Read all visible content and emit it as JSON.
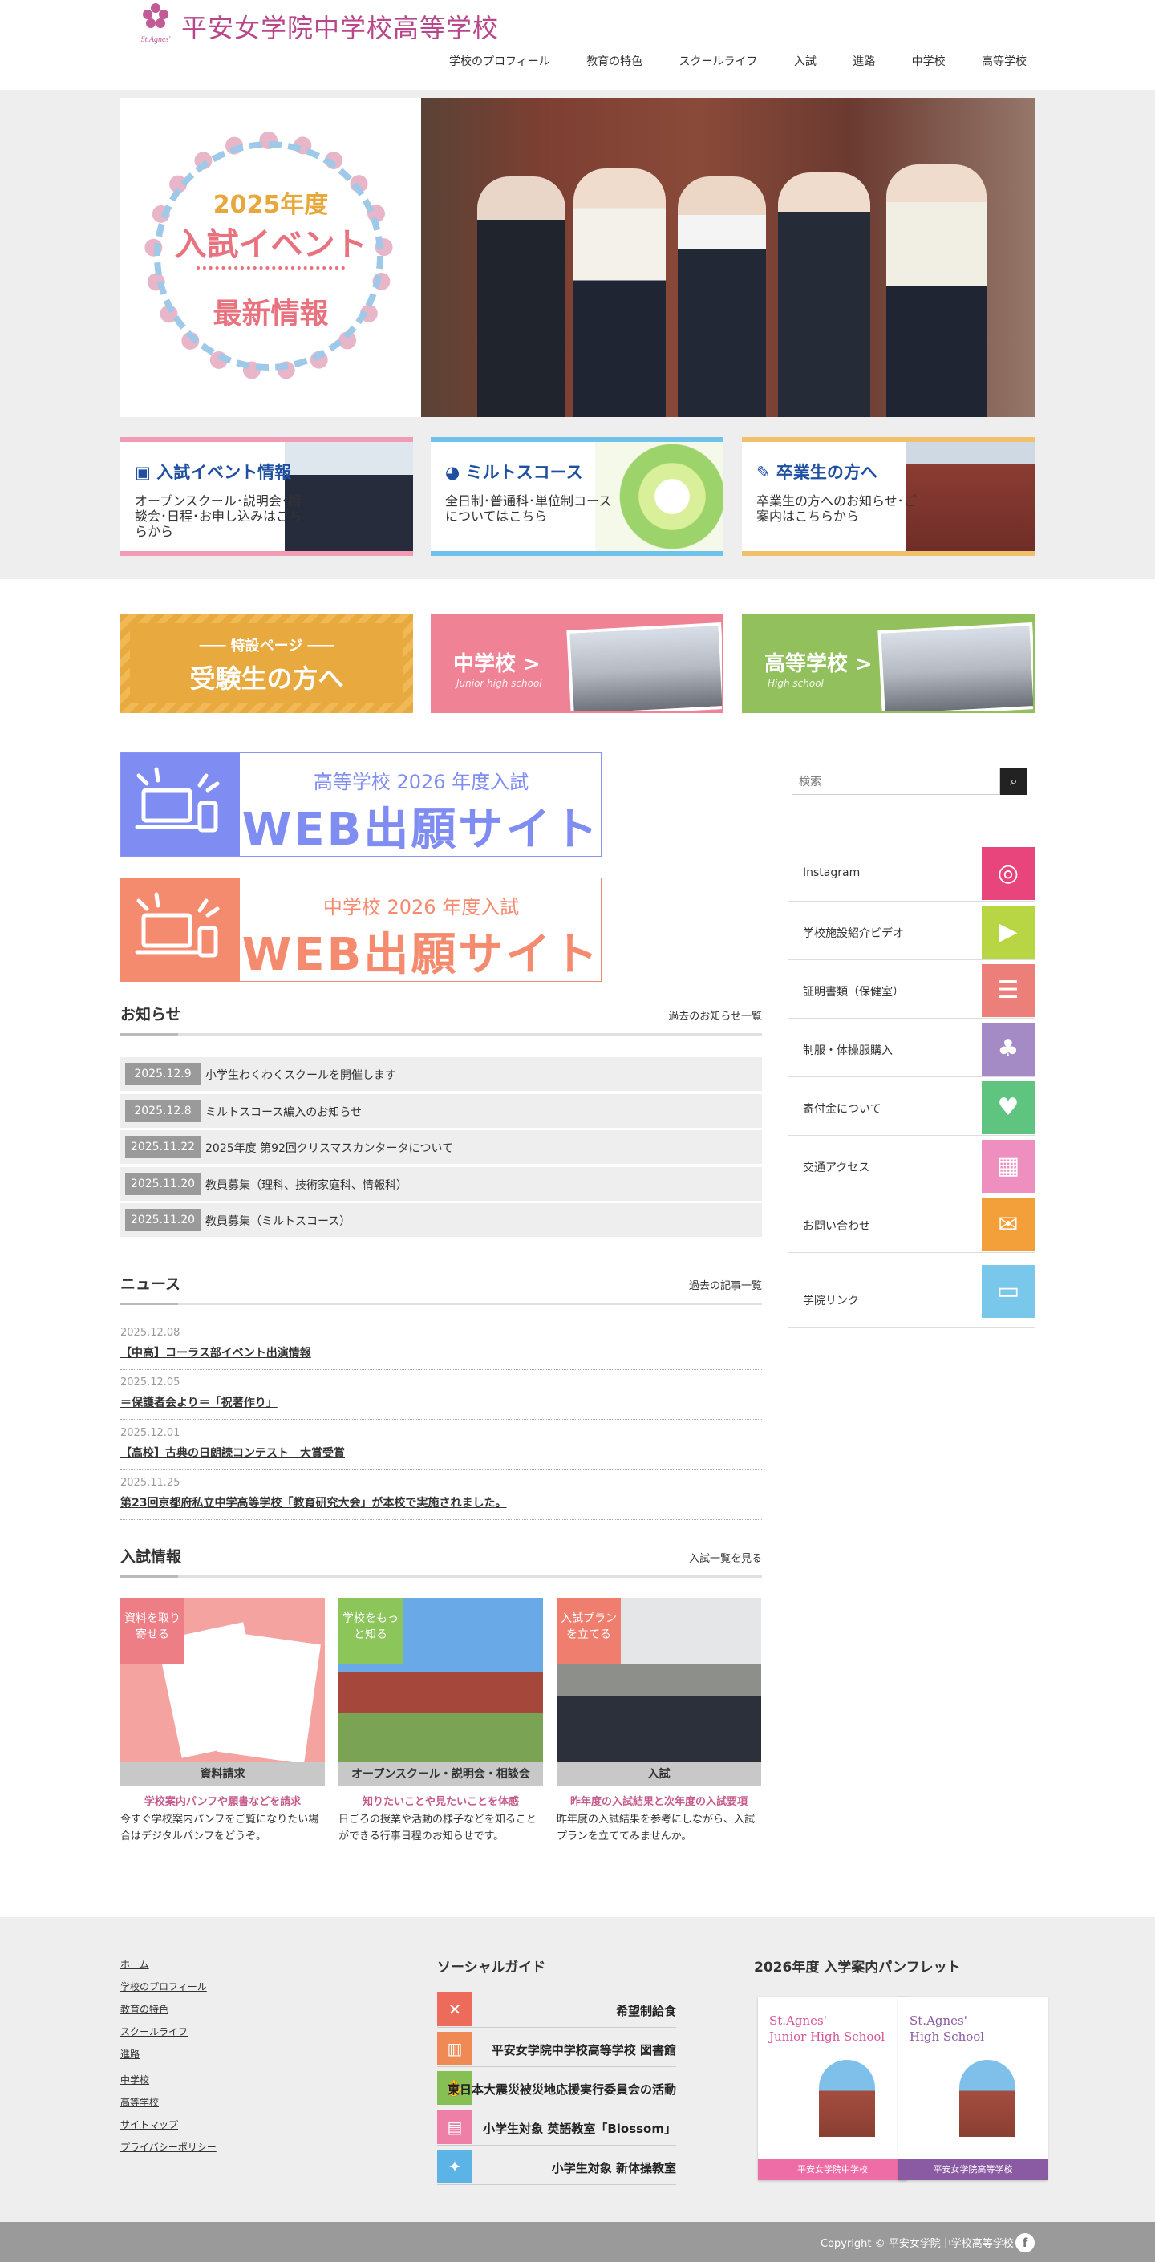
{
  "header": {
    "title": "平安女学院中学校高等学校",
    "logo_text": "St.Agnes'",
    "nav": [
      "学校のプロフィール",
      "教育の特色",
      "スクールライフ",
      "入試",
      "進路",
      "中学校",
      "高等学校"
    ]
  },
  "hero": {
    "line1": "2025年度",
    "line2": "入試イベント",
    "line3": "最新情報"
  },
  "cards": [
    {
      "title": "入試イベント情報",
      "text": "オープンスクール･説明会･相談会･日程･お申し込みはこちらから",
      "color": "#f29bb5"
    },
    {
      "title": "ミルトスコース",
      "text": "全日制･普通科･単位制コースについてはこちら",
      "color": "#6fc2ea"
    },
    {
      "title": "卒業生の方へ",
      "text": "卒業生の方へのお知らせ･ご案内はこちらから",
      "color": "#f0c16a"
    }
  ],
  "banners": {
    "tokusetsu_sub": "─── 特設ページ ───",
    "tokusetsu_main": "受験生の方へ",
    "jh_name": "中学校 >",
    "jh_en": "Junior high school",
    "hs_name": "高等学校 >",
    "hs_en": "High school"
  },
  "web": [
    {
      "sub": "高等学校 2026 年度入試",
      "main": "WEB出願サイト",
      "color": "#7f8df2"
    },
    {
      "sub": "中学校 2026 年度入試",
      "main": "WEB出願サイト",
      "color": "#f48b6e"
    }
  ],
  "notices": {
    "title": "お知らせ",
    "link": "過去のお知らせ一覧",
    "items": [
      {
        "date": "2025.12.9",
        "text": "小学生わくわくスクールを開催します"
      },
      {
        "date": "2025.12.8",
        "text": "ミルトスコース編入のお知らせ"
      },
      {
        "date": "2025.11.22",
        "text": "2025年度 第92回クリスマスカンタータについて"
      },
      {
        "date": "2025.11.20",
        "text": "教員募集（理科、技術家庭科、情報科）"
      },
      {
        "date": "2025.11.20",
        "text": "教員募集（ミルトスコース）"
      }
    ]
  },
  "news": {
    "title": "ニュース",
    "link": "過去の記事一覧",
    "items": [
      {
        "date": "2025.12.08",
        "title": "【中高】コーラス部イベント出演情報"
      },
      {
        "date": "2025.12.05",
        "title": "＝保護者会より＝「祝著作り」"
      },
      {
        "date": "2025.12.01",
        "title": "【高校】古典の日朗読コンテスト　大賞受賞"
      },
      {
        "date": "2025.11.25",
        "title": "第23回京都府私立中学高等学校「教育研究大会」が本校で実施されました。"
      }
    ]
  },
  "entrance": {
    "title": "入試情報",
    "link": "入試一覧を見る",
    "items": [
      {
        "tag": "資料を取り寄せる",
        "caption": "資料請求",
        "sub": "学校案内パンフや願書などを請求",
        "desc": "今すぐ学校案内パンフをご覧になりたい場合はデジタルパンフをどうぞ。"
      },
      {
        "tag": "学校をもっと知る",
        "caption": "オープンスクール・説明会・相談会",
        "sub": "知りたいことや見たいことを体感",
        "desc": "日ごろの授業や活動の様子などを知ることができる行事日程のお知らせです。"
      },
      {
        "tag": "入試プランを立てる",
        "caption": "入試",
        "sub": "昨年度の入試結果と次年度の入試要項",
        "desc": "昨年度の入試結果を参考にしながら、入試プランを立ててみませんか。"
      }
    ]
  },
  "search": {
    "placeholder": "検索"
  },
  "sidebar": [
    {
      "label": "Instagram",
      "icon": "instagram-icon",
      "color": "#e8457c"
    },
    {
      "label": "学校施設紹介ビデオ",
      "icon": "video-camera-icon",
      "color": "#b8d543"
    },
    {
      "label": "証明書類（保健室）",
      "icon": "clipboard-icon",
      "color": "#ec7f7a"
    },
    {
      "label": "制服・体操服購入",
      "icon": "uniform-icon",
      "color": "#a58bc5"
    },
    {
      "label": "寄付金について",
      "icon": "donation-icon",
      "color": "#5ec47f"
    },
    {
      "label": "交通アクセス",
      "icon": "bus-icon",
      "color": "#ee8fc0"
    },
    {
      "label": "お問い合わせ",
      "icon": "mail-icon",
      "color": "#f4a03a"
    },
    {
      "label": "学院リンク",
      "icon": "computer-link-icon",
      "color": "#7ac7ec"
    }
  ],
  "footer": {
    "links": [
      "ホーム",
      "学校のプロフィール",
      "教育の特色",
      "スクールライフ",
      "進路",
      "中学校",
      "高等学校",
      "サイトマップ",
      "プライバシーポリシー"
    ],
    "social_title": "ソーシャルガイド",
    "social": [
      {
        "label": "希望制給食",
        "color": "#ec6b5a"
      },
      {
        "label": "平安女学院中学校高等学校 図書館",
        "color": "#ef8a55"
      },
      {
        "label": "東日本大震災被災地応援実行委員会の活動",
        "color": "#86bf54"
      },
      {
        "label": "小学生対象 英語教室「Blossom」",
        "color": "#ee80a7"
      },
      {
        "label": "小学生対象 新体操教室",
        "color": "#5bb4e5"
      }
    ],
    "pamph_title": "2026年度 入学案内パンフレット",
    "pamphlets": [
      {
        "l1": "St.Agnes'",
        "l2": "Junior High School",
        "bar": "平安女学院中学校",
        "color": "#ef6da6",
        "tcolor": "#d6559a"
      },
      {
        "l1": "St.Agnes'",
        "l2": "High School",
        "bar": "平安女学院高等学校",
        "color": "#8a5aa2",
        "tcolor": "#8a5aa2"
      }
    ]
  },
  "copyright": "Copyright ©  平安女学院中学校高等学校",
  "facebook": "f"
}
